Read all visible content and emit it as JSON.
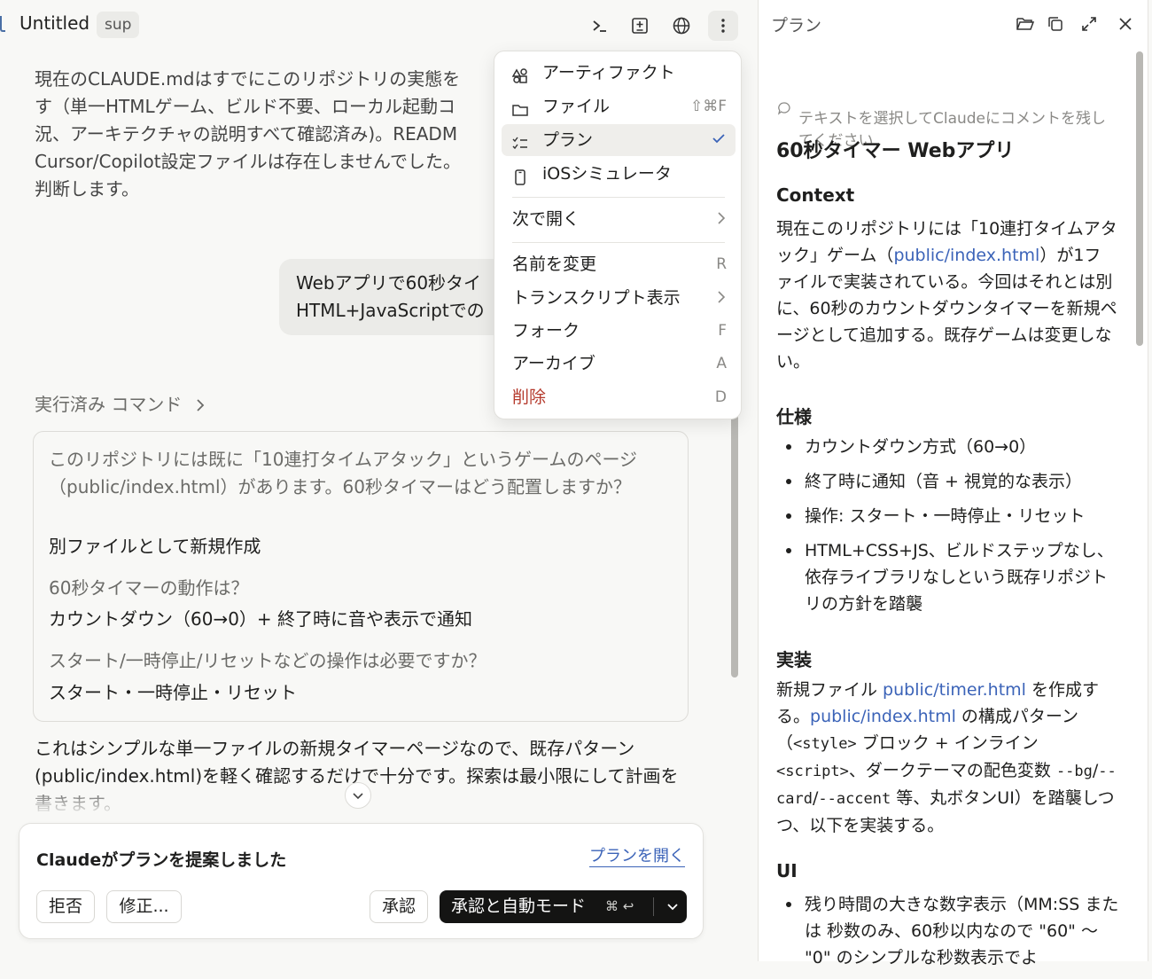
{
  "header": {
    "title": "Untitled",
    "badge": "sup"
  },
  "conversation": {
    "para1": "現在のCLAUDE.mdはすでにこのリポジトリの実態を\nす（単一HTMLゲーム、ビルド不要、ローカル起動コ\n況、アーキテクチャの説明すべて確認済み)。READM\nCursor/Copilot設定ファイルは存在しませんでした。\n判断します。",
    "user_message": "Webアプリで60秒タイ\nHTML+JavaScriptでの",
    "commands_label": "実行済み コマンド",
    "qa": [
      {
        "q": "このリポジトリには既に「10連打タイムアタック」というゲームのページ（public/index.html）があります。60秒タイマーはどう配置しますか？",
        "a": "別ファイルとして新規作成"
      },
      {
        "q": "60秒タイマーの動作は？",
        "a": "カウントダウン（60→0）+ 終了時に音や表示で通知"
      },
      {
        "q": "スタート/一時停止/リセットなどの操作は必要ですか？",
        "a": "スタート・一時停止・リセット"
      }
    ],
    "para2": "これはシンプルな単一ファイルの新規タイマーページなので、既存パターン(public/index.html)を軽く確認するだけで十分です。探索は最小限にして計画を書きます。"
  },
  "plan_card": {
    "title": "Claudeがプランを提案しました",
    "open_link": "プランを開く",
    "reject": "拒否",
    "modify": "修正...",
    "approve": "承認",
    "approve_auto": "承認と自動モード",
    "approve_auto_shortcut": "⌘ ↩"
  },
  "menu": {
    "items": [
      {
        "label": "アーティファクト",
        "icon": "artifact-icon",
        "shortcut": ""
      },
      {
        "label": "ファイル",
        "icon": "folder-icon",
        "shortcut": "⇧⌘F"
      },
      {
        "label": "プラン",
        "icon": "plan-list-icon",
        "shortcut": ""
      },
      {
        "label": "iOSシミュレータ",
        "icon": "phone-icon",
        "shortcut": ""
      }
    ],
    "open_with": "次で開く",
    "rename": "名前を変更",
    "rename_key": "R",
    "transcript": "トランスクリプト表示",
    "fork": "フォーク",
    "fork_key": "F",
    "archive": "アーカイブ",
    "archive_key": "A",
    "delete": "削除",
    "delete_key": "D"
  },
  "plan_panel": {
    "title": "プラン",
    "hint": "テキストを選択してClaudeにコメントを残し\nてください",
    "h1": "60秒タイマー Webアプリ",
    "context_heading": "Context",
    "context_pre": "現在このリポジトリには「10連打タイムアタック」ゲーム（",
    "context_link": "public/index.html",
    "context_post": "）が1ファイルで実装されている。今回はそれとは別に、60秒のカウントダウンタイマーを新規ページとして追加する。既存ゲームは変更しない。",
    "spec_heading": "仕様",
    "spec_items": [
      "カウントダウン方式（60→0）",
      "終了時に通知（音 + 視覚的な表示）",
      "操作: スタート・一時停止・リセット",
      "HTML+CSS+JS、ビルドステップなし、依存ライブラリなしという既存リポジトリの方針を踏襲"
    ],
    "impl_heading": "実装",
    "impl_t1": "新規ファイル ",
    "impl_link1": "public/timer.html",
    "impl_t2": " を作成する。",
    "impl_link2": "public/index.html",
    "impl_t3": " の構成パターン（",
    "impl_code1": "<style>",
    "impl_t4": " ブロック + インライン ",
    "impl_code2": "<script>",
    "impl_t5": "、ダークテーマの配色変数 ",
    "impl_code3": "--bg",
    "impl_t6": "/",
    "impl_code4": "--card",
    "impl_t7": "/",
    "impl_code5": "--accent",
    "impl_t8": " 等、丸ボタンUI）を踏襲しつつ、以下を実装する。",
    "ui_heading": "UI",
    "ui_items": [
      "残り時間の大きな数字表示（MM:SS または 秒数のみ、60秒以内なので \"60\" 〜 \"0\" のシンプルな秒数表示でよ"
    ]
  },
  "colors": {
    "accent_link": "#3b63b8",
    "danger": "#b53a2d",
    "primary_button": "#141413"
  }
}
